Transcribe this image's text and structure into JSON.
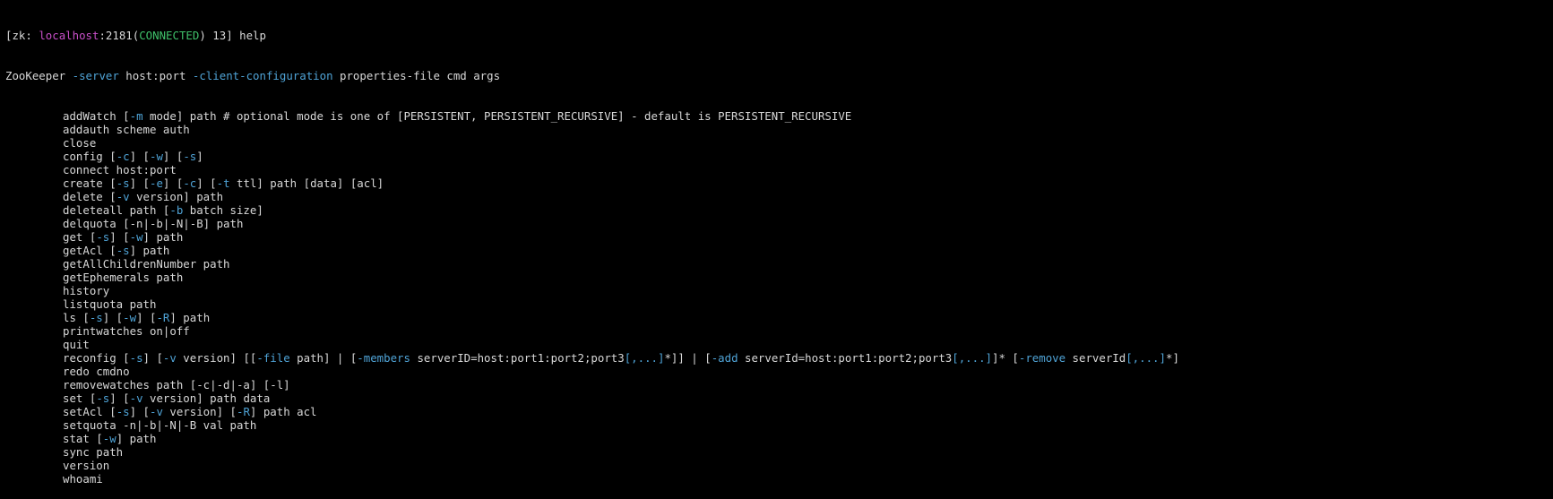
{
  "prompt": {
    "open": "[zk: ",
    "host": "localhost",
    "port": ":2181(",
    "state": "CONNECTED",
    "tail": ") 13] help"
  },
  "usage": {
    "prefix": "ZooKeeper ",
    "opt1": "-server",
    "mid": " host:port ",
    "opt2": "-client-configuration",
    "rest": " properties-file cmd args"
  },
  "colors": {
    "background": "#000000",
    "text": "#d8d8d8",
    "option": "#4fa3d6",
    "host": "#c84fc8",
    "connected": "#3fc06a"
  },
  "commands": [
    [
      {
        "t": "addWatch ["
      },
      {
        "t": "-m",
        "c": "blue"
      },
      {
        "t": " mode] path # optional mode is one of [PERSISTENT, PERSISTENT_RECURSIVE] - default is PERSISTENT_RECURSIVE"
      }
    ],
    [
      {
        "t": "addauth scheme auth"
      }
    ],
    [
      {
        "t": "close"
      }
    ],
    [
      {
        "t": "config ["
      },
      {
        "t": "-c",
        "c": "blue"
      },
      {
        "t": "] ["
      },
      {
        "t": "-w",
        "c": "blue"
      },
      {
        "t": "] ["
      },
      {
        "t": "-s",
        "c": "blue"
      },
      {
        "t": "]"
      }
    ],
    [
      {
        "t": "connect host:port"
      }
    ],
    [
      {
        "t": "create ["
      },
      {
        "t": "-s",
        "c": "blue"
      },
      {
        "t": "] ["
      },
      {
        "t": "-e",
        "c": "blue"
      },
      {
        "t": "] ["
      },
      {
        "t": "-c",
        "c": "blue"
      },
      {
        "t": "] ["
      },
      {
        "t": "-t",
        "c": "blue"
      },
      {
        "t": " ttl] path [data] [acl]"
      }
    ],
    [
      {
        "t": "delete ["
      },
      {
        "t": "-v",
        "c": "blue"
      },
      {
        "t": " version] path"
      }
    ],
    [
      {
        "t": "deleteall path ["
      },
      {
        "t": "-b",
        "c": "blue"
      },
      {
        "t": " batch size]"
      }
    ],
    [
      {
        "t": "delquota [-n|-b|-N|-B] path"
      }
    ],
    [
      {
        "t": "get ["
      },
      {
        "t": "-s",
        "c": "blue"
      },
      {
        "t": "] ["
      },
      {
        "t": "-w",
        "c": "blue"
      },
      {
        "t": "] path"
      }
    ],
    [
      {
        "t": "getAcl ["
      },
      {
        "t": "-s",
        "c": "blue"
      },
      {
        "t": "] path"
      }
    ],
    [
      {
        "t": "getAllChildrenNumber path"
      }
    ],
    [
      {
        "t": "getEphemerals path"
      }
    ],
    [
      {
        "t": "history"
      }
    ],
    [
      {
        "t": "listquota path"
      }
    ],
    [
      {
        "t": "ls ["
      },
      {
        "t": "-s",
        "c": "blue"
      },
      {
        "t": "] ["
      },
      {
        "t": "-w",
        "c": "blue"
      },
      {
        "t": "] ["
      },
      {
        "t": "-R",
        "c": "blue"
      },
      {
        "t": "] path"
      }
    ],
    [
      {
        "t": "printwatches on|off"
      }
    ],
    [
      {
        "t": "quit"
      }
    ],
    [
      {
        "t": "reconfig ["
      },
      {
        "t": "-s",
        "c": "blue"
      },
      {
        "t": "] ["
      },
      {
        "t": "-v",
        "c": "blue"
      },
      {
        "t": " version] [["
      },
      {
        "t": "-file",
        "c": "blue"
      },
      {
        "t": " path] | ["
      },
      {
        "t": "-members",
        "c": "blue"
      },
      {
        "t": " serverID=host:port1:port2;port3"
      },
      {
        "t": "[,...]",
        "c": "blue"
      },
      {
        "t": "*]] | ["
      },
      {
        "t": "-add",
        "c": "blue"
      },
      {
        "t": " serverId=host:port1:port2;port3"
      },
      {
        "t": "[,...]",
        "c": "blue"
      },
      {
        "t": "]* ["
      },
      {
        "t": "-remove",
        "c": "blue"
      },
      {
        "t": " serverId"
      },
      {
        "t": "[,...]",
        "c": "blue"
      },
      {
        "t": "*]"
      }
    ],
    [
      {
        "t": "redo cmdno"
      }
    ],
    [
      {
        "t": "removewatches path [-c|-d|-a] [-l]"
      }
    ],
    [
      {
        "t": "set ["
      },
      {
        "t": "-s",
        "c": "blue"
      },
      {
        "t": "] ["
      },
      {
        "t": "-v",
        "c": "blue"
      },
      {
        "t": " version] path data"
      }
    ],
    [
      {
        "t": "setAcl ["
      },
      {
        "t": "-s",
        "c": "blue"
      },
      {
        "t": "] ["
      },
      {
        "t": "-v",
        "c": "blue"
      },
      {
        "t": " version] ["
      },
      {
        "t": "-R",
        "c": "blue"
      },
      {
        "t": "] path acl"
      }
    ],
    [
      {
        "t": "setquota -n|-b|-N|-B val path"
      }
    ],
    [
      {
        "t": "stat ["
      },
      {
        "t": "-w",
        "c": "blue"
      },
      {
        "t": "] path"
      }
    ],
    [
      {
        "t": "sync path"
      }
    ],
    [
      {
        "t": "version"
      }
    ],
    [
      {
        "t": "whoami"
      }
    ]
  ]
}
